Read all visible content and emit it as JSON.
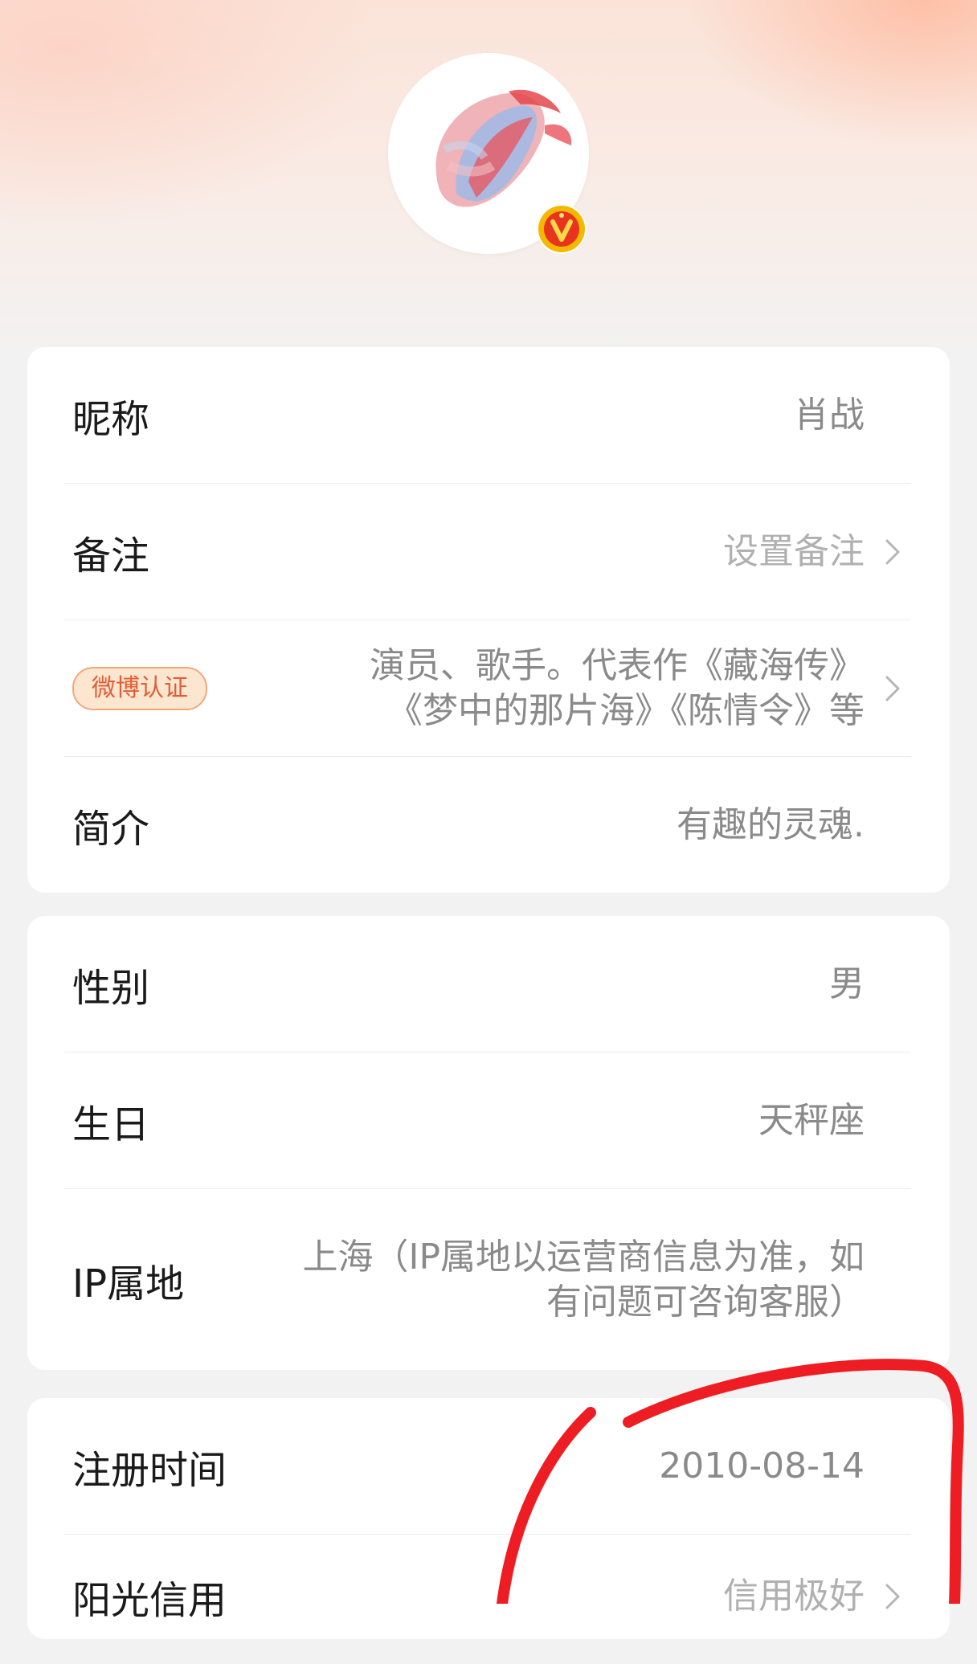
{
  "profile": {
    "avatar": {
      "verified": true
    },
    "basic": {
      "nickname_label": "昵称",
      "nickname_value": "肖战",
      "remark_label": "备注",
      "remark_value": "设置备注",
      "verify_badge": "微博认证",
      "verify_line1": "演员、歌手。代表作《藏海传》",
      "verify_line2": "《梦中的那片海》《陈情令》等",
      "intro_label": "简介",
      "intro_value": "有趣的灵魂."
    },
    "personal": {
      "gender_label": "性别",
      "gender_value": "男",
      "birthday_label": "生日",
      "birthday_value": "天秤座",
      "ip_label": "IP属地",
      "ip_line1": "上海（IP属地以运营商信息为准，如",
      "ip_line2": "有问题可咨询客服）"
    },
    "account": {
      "register_label": "注册时间",
      "register_value": "2010-08-14",
      "credit_label": "阳光信用",
      "credit_value": "信用极好"
    }
  },
  "colors": {
    "badge_text": "#e15d35",
    "badge_bg": "#fde6d0",
    "verified_gold": "#f5b800",
    "verified_red": "#e8341f",
    "annotation_red": "#ee1d23"
  },
  "icons": [
    "verified-v-icon",
    "chevron-right-icon"
  ]
}
